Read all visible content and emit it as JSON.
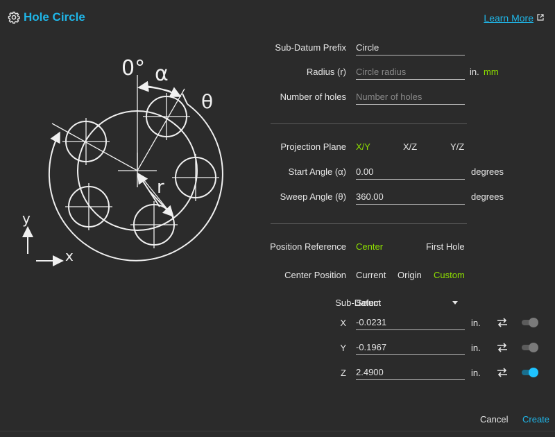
{
  "header": {
    "title": "Hole Circle",
    "learn_more": "Learn More"
  },
  "diagram": {
    "zero_label": "0°",
    "alpha_label": "α",
    "theta_label": "θ",
    "r_label": "r",
    "y_label": "y",
    "x_label": "x"
  },
  "form": {
    "prefix": {
      "label": "Sub-Datum Prefix",
      "value": "Circle"
    },
    "radius": {
      "label": "Radius (r)",
      "placeholder": "Circle radius",
      "unit_in": "in.",
      "unit_mm": "mm",
      "selected_unit": "mm"
    },
    "holes": {
      "label": "Number of holes",
      "placeholder": "Number of holes"
    },
    "plane": {
      "label": "Projection Plane",
      "options": [
        "X/Y",
        "X/Z",
        "Y/Z"
      ],
      "selected": "X/Y"
    },
    "start_angle": {
      "label": "Start Angle (α)",
      "value": "0.00",
      "unit": "degrees"
    },
    "sweep_angle": {
      "label": "Sweep Angle (θ)",
      "value": "360.00",
      "unit": "degrees"
    },
    "position_reference": {
      "label": "Position Reference",
      "options": [
        "Center",
        "First Hole"
      ],
      "selected": "Center"
    },
    "center_position": {
      "label": "Center Position",
      "options": [
        "Current",
        "Origin",
        "Custom"
      ],
      "selected": "Custom"
    },
    "sub_datum": {
      "label": "Sub-Datum",
      "value": "Select"
    },
    "coords": [
      {
        "axis": "X",
        "value": "-0.0231",
        "unit": "in.",
        "enabled": false
      },
      {
        "axis": "Y",
        "value": "-0.1967",
        "unit": "in.",
        "enabled": false
      },
      {
        "axis": "Z",
        "value": "2.4900",
        "unit": "in.",
        "enabled": true
      }
    ]
  },
  "footer": {
    "cancel": "Cancel",
    "create": "Create"
  },
  "colors": {
    "accent": "#1fb6e8",
    "selected": "#8ee000",
    "background": "#2b2b2b"
  }
}
